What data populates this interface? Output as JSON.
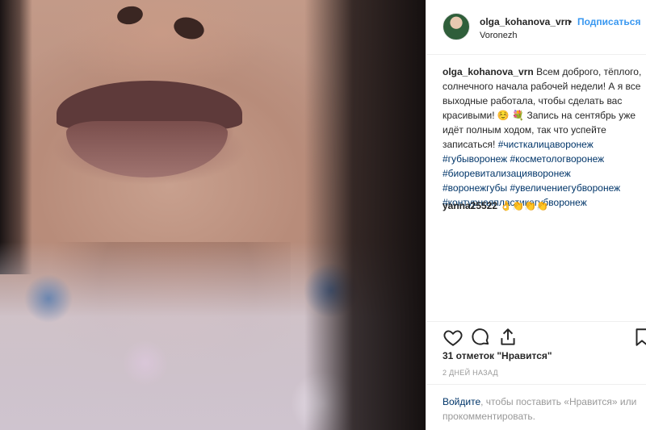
{
  "post": {
    "username": "olga_kohanova_vrn",
    "separator": "•",
    "follow_label": "Подписаться",
    "location": "Voronezh",
    "caption_user": "olga_kohanova_vrn",
    "caption_text": "Всем доброго, тёплого, солнечного начала рабочей недели! А я все выходные работала, чтобы сделать вас красивыми! ☺️ 💐 Запись на сентябрь уже идёт полным ходом, так что успейте записаться!",
    "hashtags": [
      "#чисткалицаворонеж",
      "#губыворонеж",
      "#косметологворонеж",
      "#биоревитализацияворонеж",
      "#воронежгубы",
      "#увеличениегубворонеж",
      "#контурнаяпластикагубворонеж"
    ],
    "comment_user": "yanna25522",
    "comment_text": "👌👏👏👏",
    "likes": "31 отметок \"Нравится\"",
    "time": "2 ДНЕЙ НАЗАД",
    "login_link": "Войдите",
    "login_text": ", чтобы поставить «Нравится» или прокомментировать."
  },
  "icons": {
    "like": "heart-icon",
    "comment": "comment-icon",
    "share": "share-icon",
    "save": "bookmark-icon"
  },
  "colors": {
    "link_blue": "#3897f0",
    "hashtag": "#003569",
    "text": "#262626",
    "muted": "#999999",
    "border": "#efefef"
  }
}
